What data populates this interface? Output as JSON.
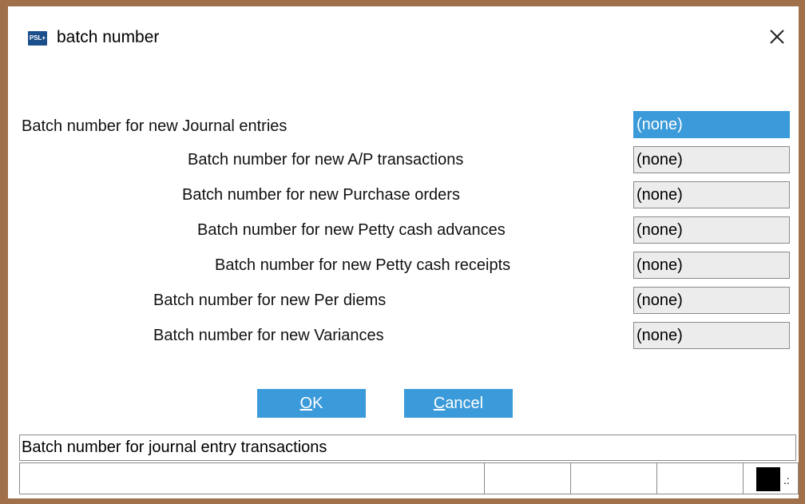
{
  "window": {
    "title": "batch number",
    "app_icon_text": "PSL+"
  },
  "fields": [
    {
      "label": "Batch number for new Journal entries",
      "value": "(none)"
    },
    {
      "label": "Batch number for new A/P transactions",
      "value": "(none)"
    },
    {
      "label": "Batch number for new Purchase orders",
      "value": "(none)"
    },
    {
      "label": "Batch number for new Petty cash advances",
      "value": "(none)"
    },
    {
      "label": "Batch number for new Petty cash receipts",
      "value": "(none)"
    },
    {
      "label": "Batch number for new Per diems",
      "value": "(none)"
    },
    {
      "label": "Batch number for new Variances",
      "value": "(none)"
    }
  ],
  "buttons": {
    "ok_mnemonic": "O",
    "ok_rest": "K",
    "cancel_mnemonic": "C",
    "cancel_rest": "ancel"
  },
  "hint_text": "Batch number for journal entry transactions",
  "colors": {
    "frame": "#a0704a",
    "accent": "#3b9ad9",
    "field_bg": "#ececec"
  }
}
